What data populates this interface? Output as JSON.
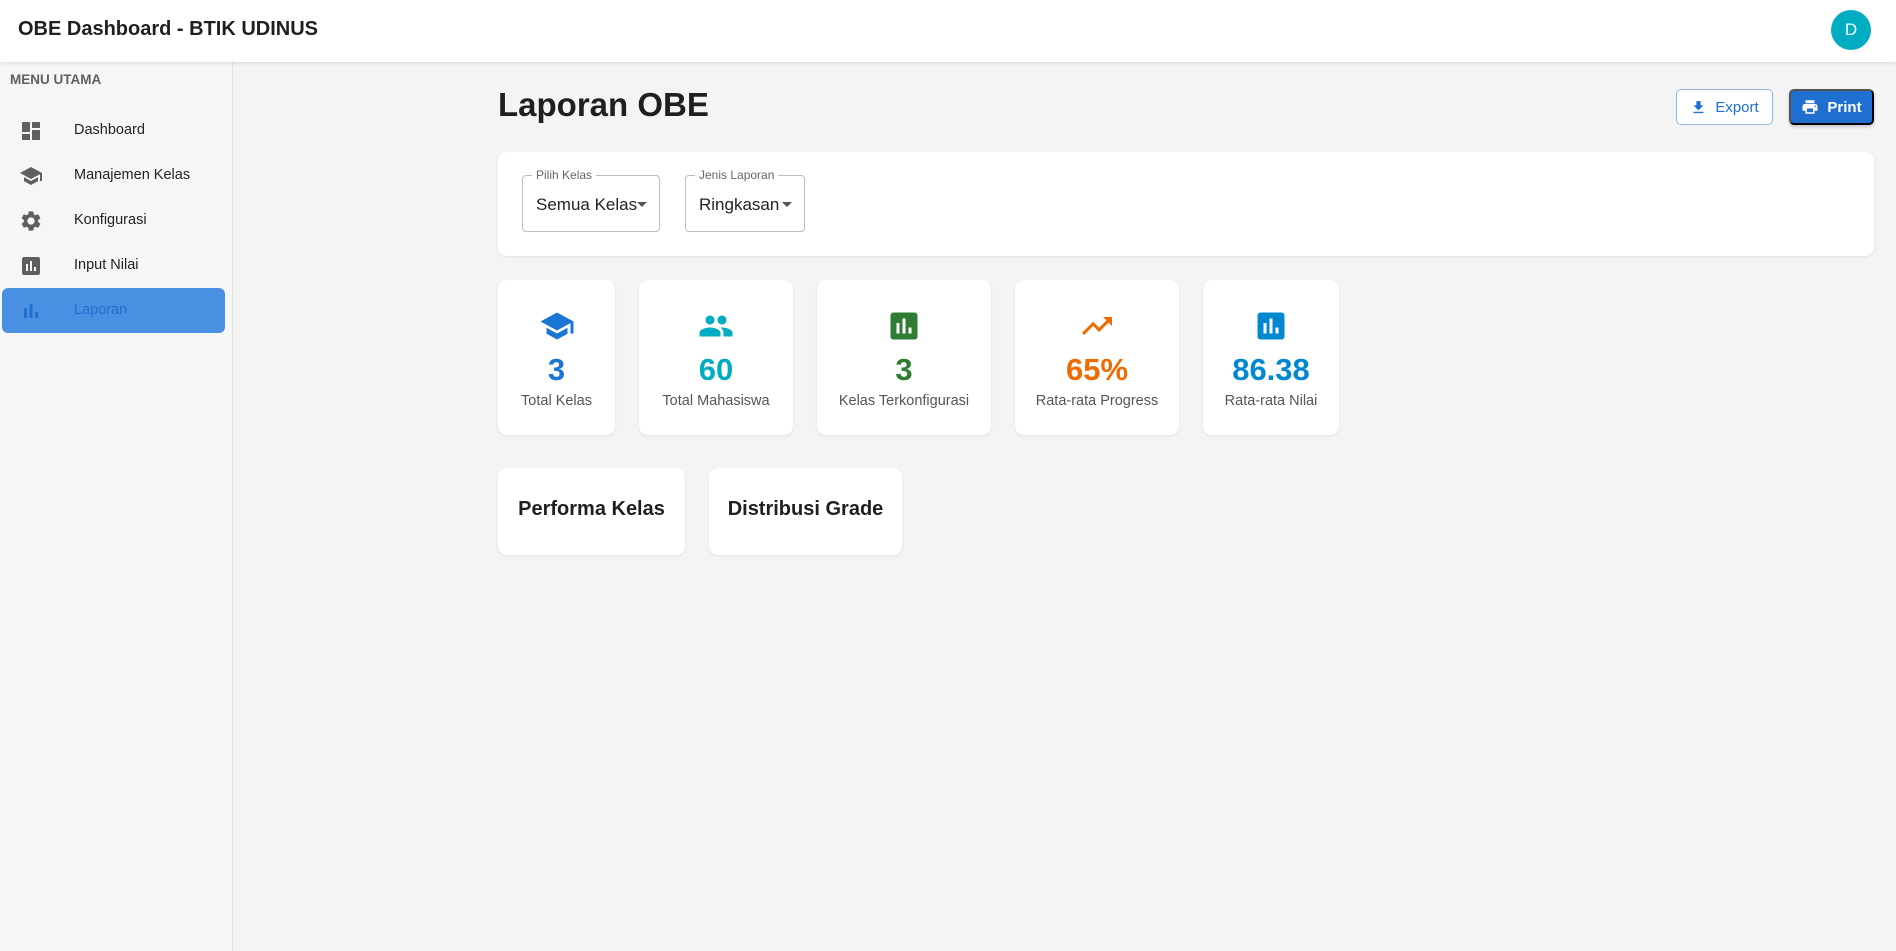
{
  "appbar": {
    "title": "OBE Dashboard - BTIK UDINUS",
    "avatar_initial": "D"
  },
  "sidebar": {
    "heading": "MENU UTAMA",
    "items": [
      {
        "label": "Dashboard",
        "icon": "dashboard-icon",
        "active": false
      },
      {
        "label": "Manajemen Kelas",
        "icon": "school-icon",
        "active": false
      },
      {
        "label": "Konfigurasi",
        "icon": "gear-icon",
        "active": false
      },
      {
        "label": "Input Nilai",
        "icon": "bar-chart-box-icon",
        "active": false
      },
      {
        "label": "Laporan",
        "icon": "bar-chart-icon",
        "active": true
      }
    ]
  },
  "page": {
    "title": "Laporan OBE",
    "export_label": "Export",
    "print_label": "Print"
  },
  "filters": {
    "kelas": {
      "legend": "Pilih Kelas",
      "value": "Semua Kelas"
    },
    "jenis": {
      "legend": "Jenis Laporan",
      "value": "Ringkasan"
    }
  },
  "stats": [
    {
      "value": "3",
      "label": "Total Kelas",
      "icon": "school-icon",
      "color": "#1976d2"
    },
    {
      "value": "60",
      "label": "Total Mahasiswa",
      "icon": "people-icon",
      "color": "#00acc1"
    },
    {
      "value": "3",
      "label": "Kelas Terkonfigurasi",
      "icon": "bar-chart-box-icon",
      "color": "#2e7d32"
    },
    {
      "value": "65%",
      "label": "Rata-rata Progress",
      "icon": "trending-up-icon",
      "color": "#ed6c02"
    },
    {
      "value": "86.38",
      "label": "Rata-rata Nilai",
      "icon": "bar-chart-box-icon",
      "color": "#0288d1"
    }
  ],
  "sections": [
    {
      "title": "Performa Kelas"
    },
    {
      "title": "Distribusi Grade"
    }
  ],
  "colors": {
    "primary": "#1e6fd0",
    "active_nav": "#4a90e2",
    "avatar": "#00acc1"
  }
}
